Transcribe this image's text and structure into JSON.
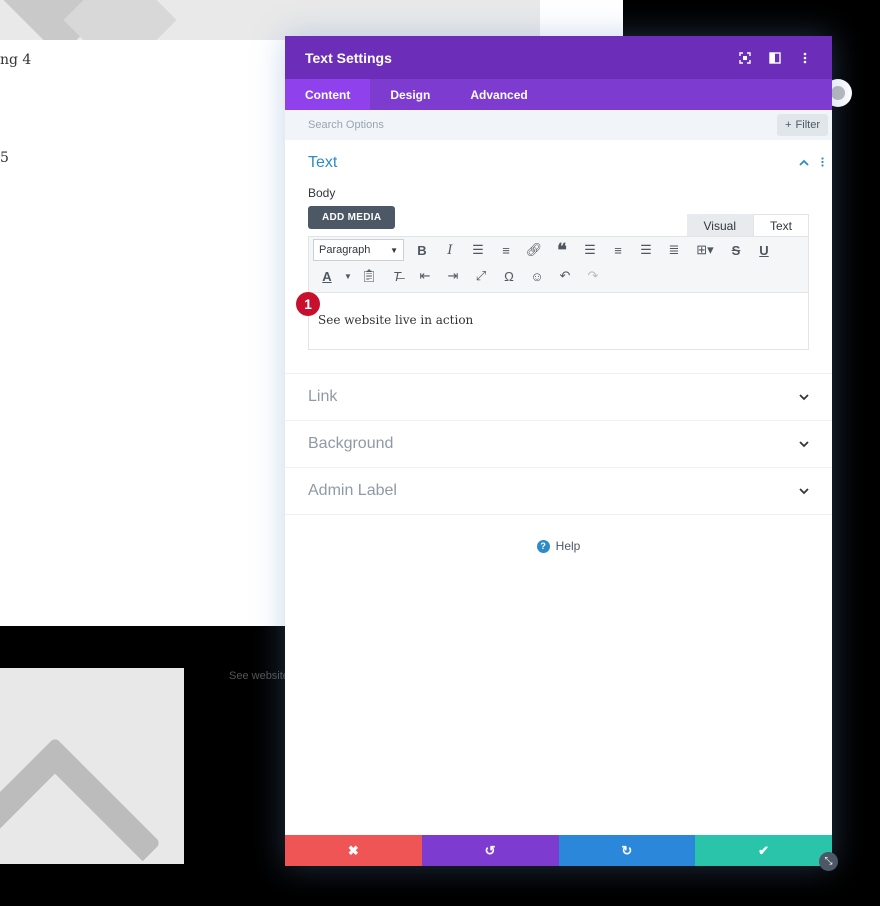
{
  "background": {
    "heading_4": "ng 4",
    "heading_5": "5",
    "dark_text": "See website"
  },
  "modal": {
    "title": "Text Settings",
    "header_icons": [
      "fullscreen-icon",
      "split-view-icon",
      "more-options-icon"
    ],
    "tabs": [
      {
        "label": "Content",
        "active": true
      },
      {
        "label": "Design",
        "active": false
      },
      {
        "label": "Advanced",
        "active": false
      }
    ],
    "search": {
      "placeholder": "Search Options",
      "filter_label": "Filter"
    },
    "text_section": {
      "title": "Text",
      "body_label": "Body",
      "add_media": "ADD MEDIA",
      "editor_tabs": {
        "visual": "Visual",
        "text": "Text"
      },
      "format_select": "Paragraph",
      "content": "See website live in action",
      "badge": "1"
    },
    "sections": [
      {
        "label": "Link"
      },
      {
        "label": "Background"
      },
      {
        "label": "Admin Label"
      }
    ],
    "help": "Help"
  },
  "colors": {
    "header": "#6c2eb9",
    "tabs": "#7e3bd0",
    "active_tab": "#8f42ec",
    "cancel": "#ef5555",
    "undo": "#7e3bd0",
    "redo": "#2b87da",
    "save": "#29c4a9",
    "accent": "#2e8bc6"
  }
}
